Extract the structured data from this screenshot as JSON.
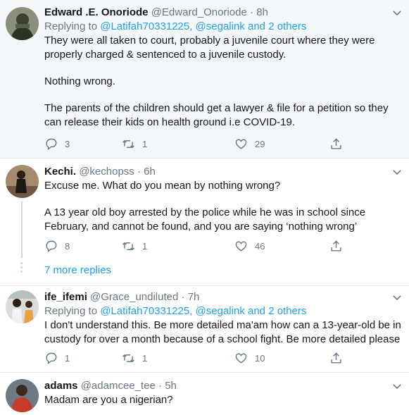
{
  "tweets": [
    {
      "name": "Edward .E. Onoriode",
      "handle": "@Edward_Onoriode",
      "time": "8h",
      "replying_prefix": "Replying to",
      "replying_users": "@Latifah70331225, @segalink",
      "replying_suffix": "and 2 others",
      "paragraphs": [
        "They were all taken to court, probably a juvenile court where they were properly charged & sentenced to a juvenile custody.",
        "Nothing wrong.",
        "The parents of the children should get a lawyer & file for a petition so they can release their kids on health ground i.e COVID-19."
      ],
      "replies": "3",
      "retweets": "1",
      "likes": "29"
    },
    {
      "name": "Kechi.",
      "handle": "@kechopss",
      "time": "6h",
      "paragraphs": [
        "Excuse me. What do you mean by nothing wrong?",
        "A 13 year old boy arrested by the police while he was in school since February, and cannot be found, and you are saying ‘nothing wrong’"
      ],
      "replies": "8",
      "retweets": "1",
      "likes": "46"
    },
    {
      "name": "ife_ifemi",
      "handle": "@Grace_undiluted",
      "time": "7h",
      "replying_prefix": "Replying to",
      "replying_users": "@Latifah70331225, @segalink",
      "replying_suffix": "and 2 others",
      "paragraphs": [
        "I don't understand this. Be more detailed ma'am how can a 13-year-old be in custody for over a month because of a school fight. Be more detailed please"
      ],
      "replies": "1",
      "retweets": "1",
      "likes": "10"
    },
    {
      "name": "adams",
      "handle": "@adamcee_tee",
      "time": "5h",
      "paragraphs": [
        "Madam are you a nigerian?"
      ]
    }
  ],
  "more_replies": "7 more replies",
  "dot": "·",
  "icons": {
    "reply": "reply-icon",
    "retweet": "retweet-icon",
    "like": "heart-icon",
    "share": "share-icon",
    "menu": "chevron-down-icon"
  },
  "colors": {
    "accent": "#1da1f2",
    "muted": "#657786",
    "highlight_bg": "#f5f8fa"
  }
}
